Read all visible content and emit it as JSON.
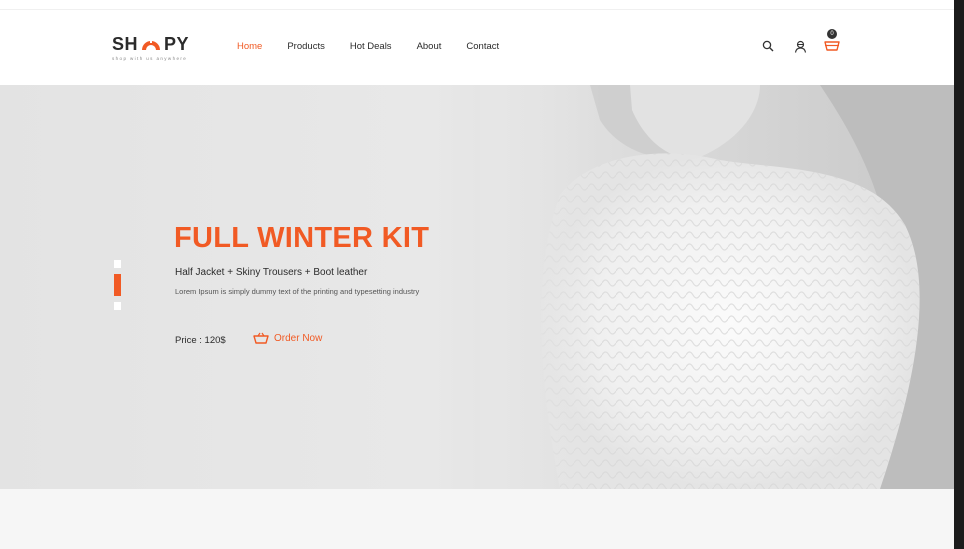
{
  "brand": {
    "name_left": "SH",
    "name_right": "PY",
    "tagline": "shop with us anywhere",
    "accent_color": "#f15a24"
  },
  "nav": {
    "items": [
      {
        "label": "Home",
        "active": true
      },
      {
        "label": "Products",
        "active": false
      },
      {
        "label": "Hot Deals",
        "active": false
      },
      {
        "label": "About",
        "active": false
      },
      {
        "label": "Contact",
        "active": false
      }
    ]
  },
  "header_icons": {
    "search": "search-icon",
    "user": "user-icon",
    "cart": "cart-icon",
    "cart_count": "0"
  },
  "hero": {
    "title": "FULL WINTER KIT",
    "subtitle": "Half Jacket + Skiny Trousers + Boot leather",
    "description": "Lorem Ipsum is simply dummy text of the printing and typesetting industry",
    "price": "Price : 120$",
    "order_label": "Order Now",
    "order_icon": "basket-icon",
    "slides": 3,
    "active_slide": 2
  }
}
